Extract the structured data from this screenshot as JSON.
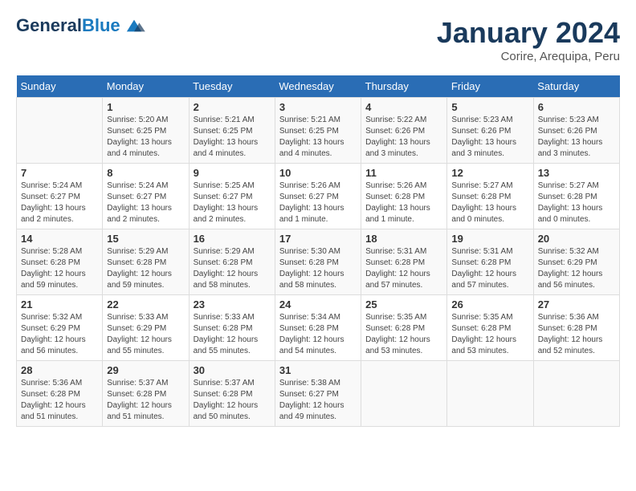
{
  "header": {
    "logo_line1": "General",
    "logo_line2": "Blue",
    "month": "January 2024",
    "location": "Corire, Arequipa, Peru"
  },
  "weekdays": [
    "Sunday",
    "Monday",
    "Tuesday",
    "Wednesday",
    "Thursday",
    "Friday",
    "Saturday"
  ],
  "weeks": [
    [
      {
        "num": "",
        "sunrise": "",
        "sunset": "",
        "daylight": ""
      },
      {
        "num": "1",
        "sunrise": "Sunrise: 5:20 AM",
        "sunset": "Sunset: 6:25 PM",
        "daylight": "Daylight: 13 hours and 4 minutes."
      },
      {
        "num": "2",
        "sunrise": "Sunrise: 5:21 AM",
        "sunset": "Sunset: 6:25 PM",
        "daylight": "Daylight: 13 hours and 4 minutes."
      },
      {
        "num": "3",
        "sunrise": "Sunrise: 5:21 AM",
        "sunset": "Sunset: 6:25 PM",
        "daylight": "Daylight: 13 hours and 4 minutes."
      },
      {
        "num": "4",
        "sunrise": "Sunrise: 5:22 AM",
        "sunset": "Sunset: 6:26 PM",
        "daylight": "Daylight: 13 hours and 3 minutes."
      },
      {
        "num": "5",
        "sunrise": "Sunrise: 5:23 AM",
        "sunset": "Sunset: 6:26 PM",
        "daylight": "Daylight: 13 hours and 3 minutes."
      },
      {
        "num": "6",
        "sunrise": "Sunrise: 5:23 AM",
        "sunset": "Sunset: 6:26 PM",
        "daylight": "Daylight: 13 hours and 3 minutes."
      }
    ],
    [
      {
        "num": "7",
        "sunrise": "Sunrise: 5:24 AM",
        "sunset": "Sunset: 6:27 PM",
        "daylight": "Daylight: 13 hours and 2 minutes."
      },
      {
        "num": "8",
        "sunrise": "Sunrise: 5:24 AM",
        "sunset": "Sunset: 6:27 PM",
        "daylight": "Daylight: 13 hours and 2 minutes."
      },
      {
        "num": "9",
        "sunrise": "Sunrise: 5:25 AM",
        "sunset": "Sunset: 6:27 PM",
        "daylight": "Daylight: 13 hours and 2 minutes."
      },
      {
        "num": "10",
        "sunrise": "Sunrise: 5:26 AM",
        "sunset": "Sunset: 6:27 PM",
        "daylight": "Daylight: 13 hours and 1 minute."
      },
      {
        "num": "11",
        "sunrise": "Sunrise: 5:26 AM",
        "sunset": "Sunset: 6:28 PM",
        "daylight": "Daylight: 13 hours and 1 minute."
      },
      {
        "num": "12",
        "sunrise": "Sunrise: 5:27 AM",
        "sunset": "Sunset: 6:28 PM",
        "daylight": "Daylight: 13 hours and 0 minutes."
      },
      {
        "num": "13",
        "sunrise": "Sunrise: 5:27 AM",
        "sunset": "Sunset: 6:28 PM",
        "daylight": "Daylight: 13 hours and 0 minutes."
      }
    ],
    [
      {
        "num": "14",
        "sunrise": "Sunrise: 5:28 AM",
        "sunset": "Sunset: 6:28 PM",
        "daylight": "Daylight: 12 hours and 59 minutes."
      },
      {
        "num": "15",
        "sunrise": "Sunrise: 5:29 AM",
        "sunset": "Sunset: 6:28 PM",
        "daylight": "Daylight: 12 hours and 59 minutes."
      },
      {
        "num": "16",
        "sunrise": "Sunrise: 5:29 AM",
        "sunset": "Sunset: 6:28 PM",
        "daylight": "Daylight: 12 hours and 58 minutes."
      },
      {
        "num": "17",
        "sunrise": "Sunrise: 5:30 AM",
        "sunset": "Sunset: 6:28 PM",
        "daylight": "Daylight: 12 hours and 58 minutes."
      },
      {
        "num": "18",
        "sunrise": "Sunrise: 5:31 AM",
        "sunset": "Sunset: 6:28 PM",
        "daylight": "Daylight: 12 hours and 57 minutes."
      },
      {
        "num": "19",
        "sunrise": "Sunrise: 5:31 AM",
        "sunset": "Sunset: 6:28 PM",
        "daylight": "Daylight: 12 hours and 57 minutes."
      },
      {
        "num": "20",
        "sunrise": "Sunrise: 5:32 AM",
        "sunset": "Sunset: 6:29 PM",
        "daylight": "Daylight: 12 hours and 56 minutes."
      }
    ],
    [
      {
        "num": "21",
        "sunrise": "Sunrise: 5:32 AM",
        "sunset": "Sunset: 6:29 PM",
        "daylight": "Daylight: 12 hours and 56 minutes."
      },
      {
        "num": "22",
        "sunrise": "Sunrise: 5:33 AM",
        "sunset": "Sunset: 6:29 PM",
        "daylight": "Daylight: 12 hours and 55 minutes."
      },
      {
        "num": "23",
        "sunrise": "Sunrise: 5:33 AM",
        "sunset": "Sunset: 6:28 PM",
        "daylight": "Daylight: 12 hours and 55 minutes."
      },
      {
        "num": "24",
        "sunrise": "Sunrise: 5:34 AM",
        "sunset": "Sunset: 6:28 PM",
        "daylight": "Daylight: 12 hours and 54 minutes."
      },
      {
        "num": "25",
        "sunrise": "Sunrise: 5:35 AM",
        "sunset": "Sunset: 6:28 PM",
        "daylight": "Daylight: 12 hours and 53 minutes."
      },
      {
        "num": "26",
        "sunrise": "Sunrise: 5:35 AM",
        "sunset": "Sunset: 6:28 PM",
        "daylight": "Daylight: 12 hours and 53 minutes."
      },
      {
        "num": "27",
        "sunrise": "Sunrise: 5:36 AM",
        "sunset": "Sunset: 6:28 PM",
        "daylight": "Daylight: 12 hours and 52 minutes."
      }
    ],
    [
      {
        "num": "28",
        "sunrise": "Sunrise: 5:36 AM",
        "sunset": "Sunset: 6:28 PM",
        "daylight": "Daylight: 12 hours and 51 minutes."
      },
      {
        "num": "29",
        "sunrise": "Sunrise: 5:37 AM",
        "sunset": "Sunset: 6:28 PM",
        "daylight": "Daylight: 12 hours and 51 minutes."
      },
      {
        "num": "30",
        "sunrise": "Sunrise: 5:37 AM",
        "sunset": "Sunset: 6:28 PM",
        "daylight": "Daylight: 12 hours and 50 minutes."
      },
      {
        "num": "31",
        "sunrise": "Sunrise: 5:38 AM",
        "sunset": "Sunset: 6:27 PM",
        "daylight": "Daylight: 12 hours and 49 minutes."
      },
      {
        "num": "",
        "sunrise": "",
        "sunset": "",
        "daylight": ""
      },
      {
        "num": "",
        "sunrise": "",
        "sunset": "",
        "daylight": ""
      },
      {
        "num": "",
        "sunrise": "",
        "sunset": "",
        "daylight": ""
      }
    ]
  ]
}
